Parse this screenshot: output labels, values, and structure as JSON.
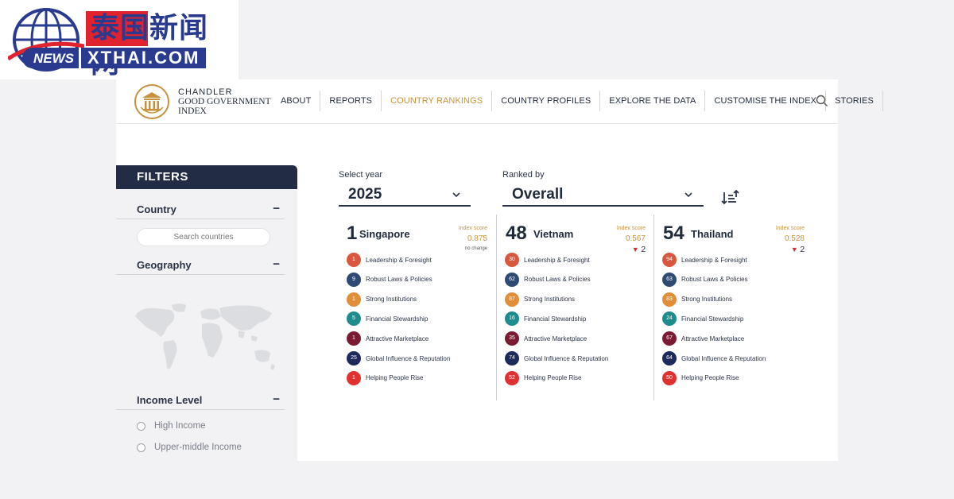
{
  "watermark": {
    "cn_text": "泰国新闻网",
    "en_news": "NEWS",
    "en_domain": "XTHAI.COM"
  },
  "header": {
    "brand_line1": "CHANDLER",
    "brand_line2": "GOOD GOVERNMENT",
    "brand_line3": "INDEX",
    "nav": [
      {
        "label": "ABOUT"
      },
      {
        "label": "REPORTS"
      },
      {
        "label": "COUNTRY RANKINGS"
      },
      {
        "label": "COUNTRY PROFILES"
      },
      {
        "label": "EXPLORE THE DATA"
      },
      {
        "label": "CUSTOMISE THE INDEX"
      },
      {
        "label": "STORIES"
      }
    ],
    "active_nav": "COUNTRY RANKINGS"
  },
  "filters": {
    "title": "FILTERS",
    "country_title": "Country",
    "search_placeholder": "Search countries",
    "geography_title": "Geography",
    "income_title": "Income Level",
    "toggle": "−",
    "income_options": [
      "High Income",
      "Upper-middle Income"
    ]
  },
  "controls": {
    "year_label": "Select year",
    "year_value": "2025",
    "ranked_label": "Ranked by",
    "ranked_value": "Overall"
  },
  "countries": [
    {
      "rank": "1",
      "name": "Singapore",
      "score_label": "Index score",
      "score": "0.875",
      "change": "no change",
      "change_dir": "none",
      "pillars": [
        "1",
        "9",
        "1",
        "5",
        "1",
        "25",
        "1"
      ]
    },
    {
      "rank": "48",
      "name": "Vietnam",
      "score_label": "Index score",
      "score": "0.567",
      "change": "2",
      "change_dir": "down",
      "pillars": [
        "30",
        "62",
        "87",
        "16",
        "35",
        "74",
        "52"
      ]
    },
    {
      "rank": "54",
      "name": "Thailand",
      "score_label": "Index score",
      "score": "0.528",
      "change": "2",
      "change_dir": "down",
      "pillars": [
        "94",
        "63",
        "83",
        "24",
        "67",
        "64",
        "50"
      ]
    }
  ],
  "pillar_names": [
    "Leadership & Foresight",
    "Robust Laws & Policies",
    "Strong Institutions",
    "Financial Stewardship",
    "Attractive Marketplace",
    "Global Influence & Reputation",
    "Helping People Rise"
  ],
  "pillar_colors": [
    "#d9573c",
    "#2f4a73",
    "#e08f38",
    "#1e8b8c",
    "#7a1a33",
    "#1d2a5c",
    "#e03030"
  ],
  "colors": {
    "accent": "#c8923d",
    "navy": "#222d45",
    "down": "#d32f2f"
  }
}
